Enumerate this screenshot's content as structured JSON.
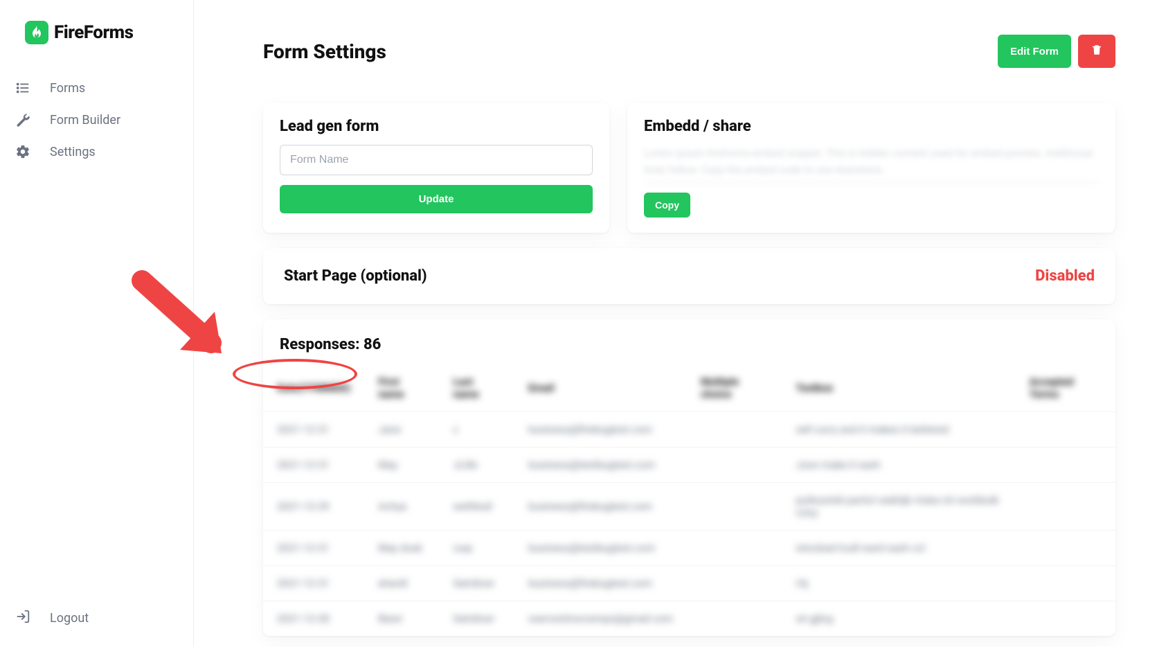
{
  "brand": {
    "name": "FireForms"
  },
  "sidebar": {
    "items": [
      {
        "label": "Forms"
      },
      {
        "label": "Form Builder"
      },
      {
        "label": "Settings"
      }
    ],
    "logout": "Logout"
  },
  "header": {
    "title": "Form Settings",
    "edit": "Edit Form"
  },
  "leadgen": {
    "title": "Lead gen form",
    "placeholder": "Form Name",
    "value": "",
    "update": "Update"
  },
  "embed": {
    "title": "Embedd / share",
    "code_preview": "Lorem ipsum fireforms-embed snippet. This is hidden content used for embed preview. Additional lines follow. Copy the embed code to use elsewhere.",
    "copy": "Copy"
  },
  "startpage": {
    "title": "Start Page (optional)",
    "status": "Disabled"
  },
  "responses": {
    "title": "Responses: 86",
    "columns": [
      "Date(YYMMDD)",
      "First name",
      "Last name",
      "Email",
      "Multiple choice",
      "Textbox",
      "Accepted Terms"
    ],
    "rows": [
      [
        "2021-12-31",
        "Jane",
        "c",
        "business@firebugtest.com",
        "",
        "sell curry and it makes it bettered",
        ""
      ],
      [
        "2021-12-31",
        "May",
        "JLille",
        "business@testbugtest.com",
        "",
        "Joon make it sash",
        ""
      ],
      [
        "2021-12-29",
        "Achya",
        "wethbull",
        "business@firebugtest.com",
        "",
        "putbusinbl particl webtijk rtules int workbulk rcloy",
        ""
      ],
      [
        "2021-12-31",
        "May dusk",
        "ruay",
        "business@testbugtest.com",
        "",
        "wtocbad trudl ward sash ccl",
        ""
      ],
      [
        "2021-12-31",
        "ehardt",
        "Satrdicer",
        "business@firebugtest.com",
        "",
        "rtij",
        ""
      ],
      [
        "2021-12-28",
        "Barer",
        "Satrdicer",
        "warrowitnorcemps@gmail.com",
        "",
        "wt gjbrg",
        ""
      ]
    ]
  }
}
